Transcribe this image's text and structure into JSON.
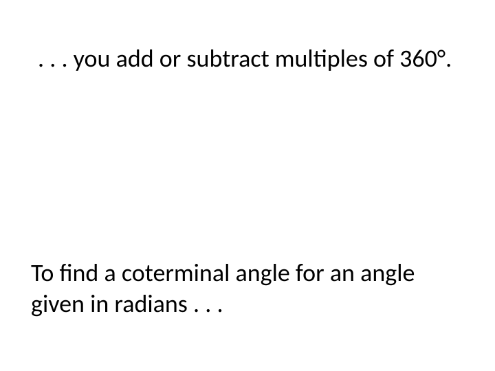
{
  "slide": {
    "paragraph1": ". . . you add or subtract multiples of 360°.",
    "paragraph2": "To find a coterminal angle for an angle given in radians . . ."
  }
}
